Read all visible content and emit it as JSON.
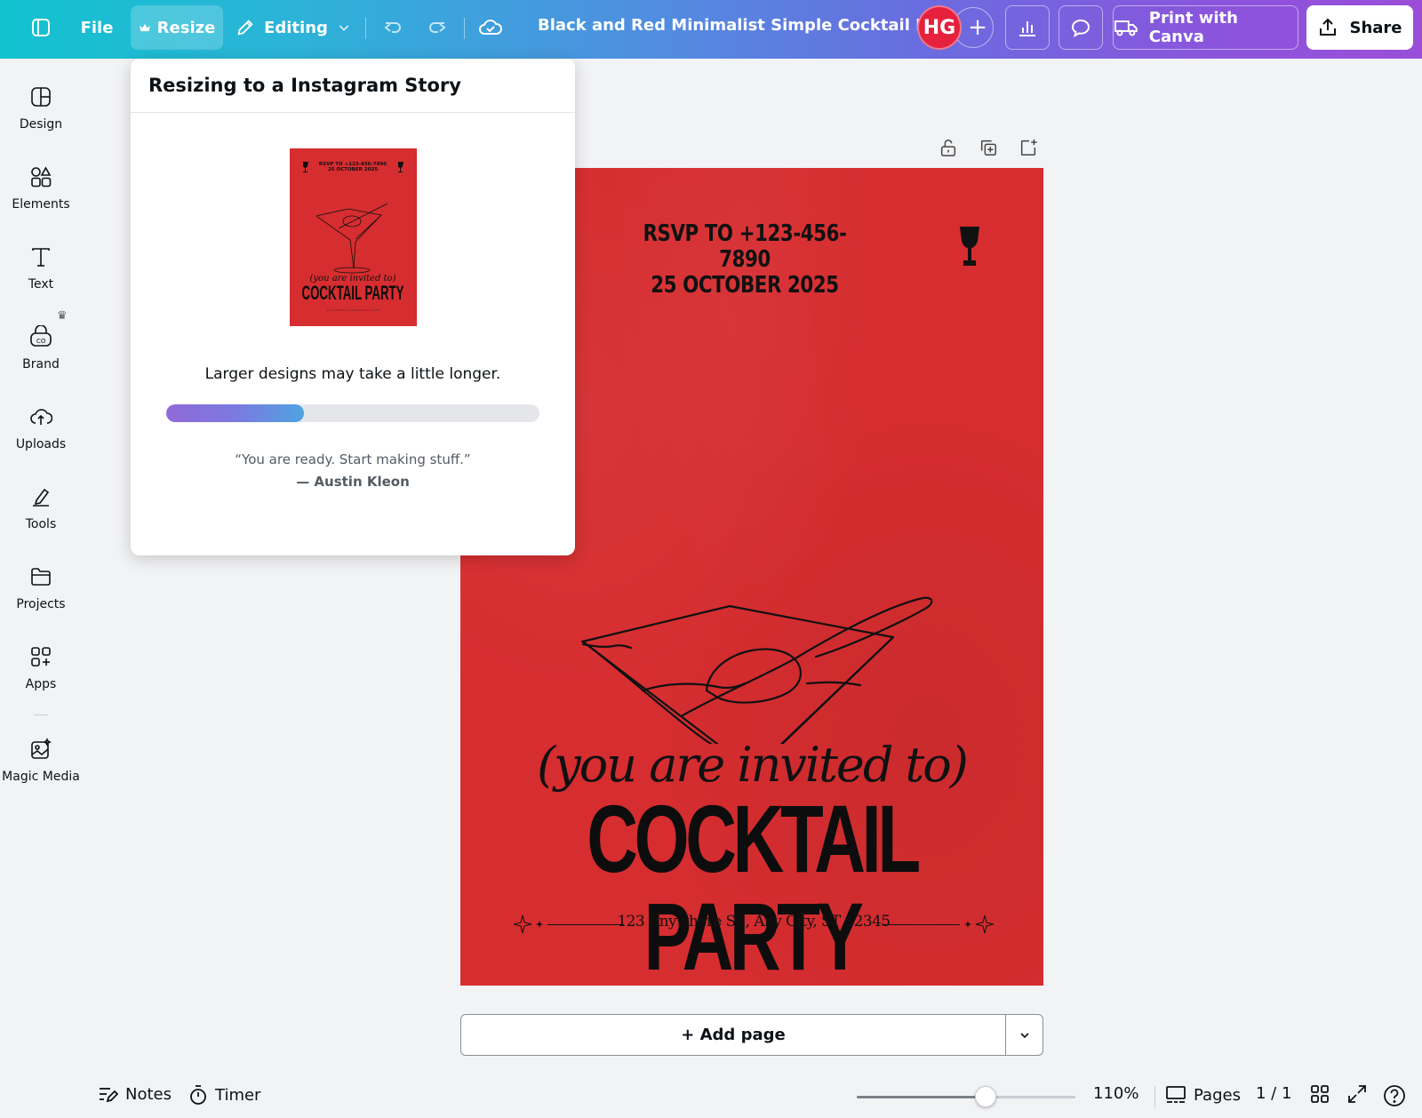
{
  "topbar": {
    "file_label": "File",
    "resize_label": "Resize",
    "editing_label": "Editing",
    "title": "Black and Red Minimalist Simple Cocktail Par...",
    "avatar_initials": "HG",
    "add_collaborator": "+",
    "print_label": "Print with Canva",
    "share_label": "Share"
  },
  "sidebar": {
    "items": [
      {
        "label": "Design",
        "icon": "design-icon"
      },
      {
        "label": "Elements",
        "icon": "elements-icon"
      },
      {
        "label": "Text",
        "icon": "text-icon"
      },
      {
        "label": "Brand",
        "icon": "brand-icon"
      },
      {
        "label": "Uploads",
        "icon": "uploads-icon"
      },
      {
        "label": "Tools",
        "icon": "tools-icon"
      },
      {
        "label": "Projects",
        "icon": "projects-icon"
      },
      {
        "label": "Apps",
        "icon": "apps-icon"
      },
      {
        "label": "Magic Media",
        "icon": "magic-media-icon"
      }
    ]
  },
  "popover": {
    "title": "Resizing to a Instagram Story",
    "message": "Larger designs may take a little longer.",
    "progress_fraction": 0.37,
    "quote": "“You are ready. Start making stuff.”",
    "author": "— Austin Kleon"
  },
  "poster": {
    "rsvp_line1": "RSVP TO +123-456-7890",
    "rsvp_line2": "25 OCTOBER 2025",
    "invited": "(you are invited to)",
    "headline": "COCKTAIL PARTY",
    "address": "123 Anywhere St., Any City, ST 12345",
    "background_color": "#d62d30"
  },
  "thumbnail": {
    "rsvp_line1": "RSVP TO +123-456-7890",
    "rsvp_line2": "25 OCTOBER 2025",
    "invited": "(you are invited to)",
    "headline": "COCKTAIL PARTY"
  },
  "canvas": {
    "add_page_label": "+ Add page"
  },
  "bottombar": {
    "notes_label": "Notes",
    "timer_label": "Timer",
    "zoom_fraction": 0.59,
    "zoom_label": "110%",
    "pages_label": "Pages",
    "page_count": "1 / 1"
  },
  "colors": {
    "accent_red": "#e5213e",
    "poster_red": "#d62d30"
  }
}
